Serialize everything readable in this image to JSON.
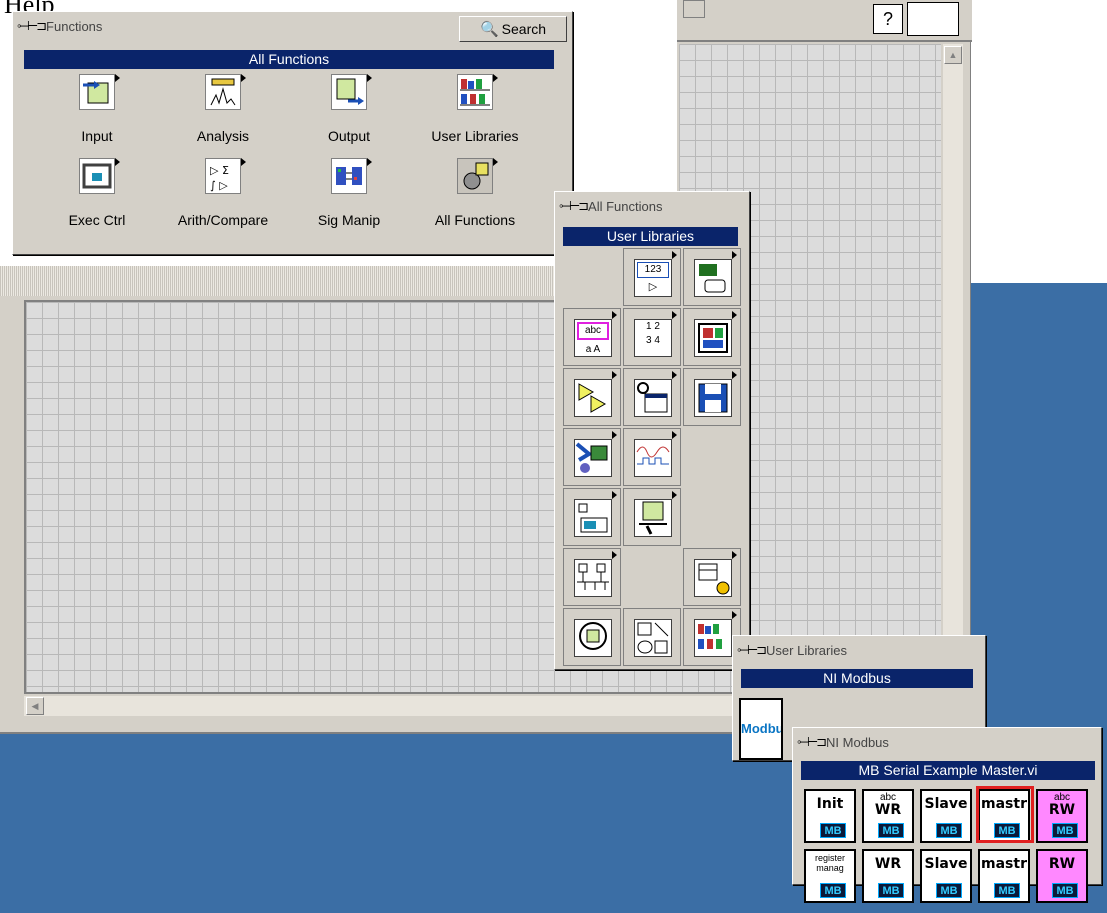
{
  "page_text": "Help",
  "functions_palette": {
    "title": "Functions",
    "search_label": "Search",
    "header": "All Functions",
    "items": [
      {
        "label": "Input",
        "icon": "input-icon"
      },
      {
        "label": "Analysis",
        "icon": "analysis-icon"
      },
      {
        "label": "Output",
        "icon": "output-icon"
      },
      {
        "label": "User Libraries",
        "icon": "user-libraries-icon"
      },
      {
        "label": "Exec Ctrl",
        "icon": "exec-ctrl-icon"
      },
      {
        "label": "Arith/Compare",
        "icon": "arith-compare-icon"
      },
      {
        "label": "Sig Manip",
        "icon": "sig-manip-icon"
      },
      {
        "label": "All Functions",
        "icon": "all-functions-icon"
      }
    ]
  },
  "all_functions_palette": {
    "title": "All Functions",
    "header": "User Libraries",
    "icon_texts": {
      "numeric": "123",
      "string": "abc"
    }
  },
  "user_libraries_palette": {
    "title": "User Libraries",
    "header": "NI Modbus",
    "item_label": "Modbus"
  },
  "modbus_palette": {
    "title": "NI Modbus",
    "header": "MB Serial Example Master.vi",
    "row1": [
      {
        "text": "Init",
        "tag": "MB"
      },
      {
        "small": "abc",
        "text": "WR",
        "tag": "MB"
      },
      {
        "text": "Slave",
        "tag": "MB"
      },
      {
        "text": "mastr",
        "tag": "MB"
      },
      {
        "small": "abc",
        "text": "RW",
        "tag": "MB"
      }
    ],
    "row2": [
      {
        "small": "register manag",
        "tag": "MB"
      },
      {
        "text": "WR",
        "tag": "MB"
      },
      {
        "text": "Slave",
        "tag": "MB"
      },
      {
        "text": "mastr",
        "tag": "MB"
      },
      {
        "text": "RW",
        "tag": "MB"
      }
    ]
  },
  "colors": {
    "desktop": "#3b6ea5",
    "palette_header": "#0a246a",
    "selection": "#e02020"
  }
}
